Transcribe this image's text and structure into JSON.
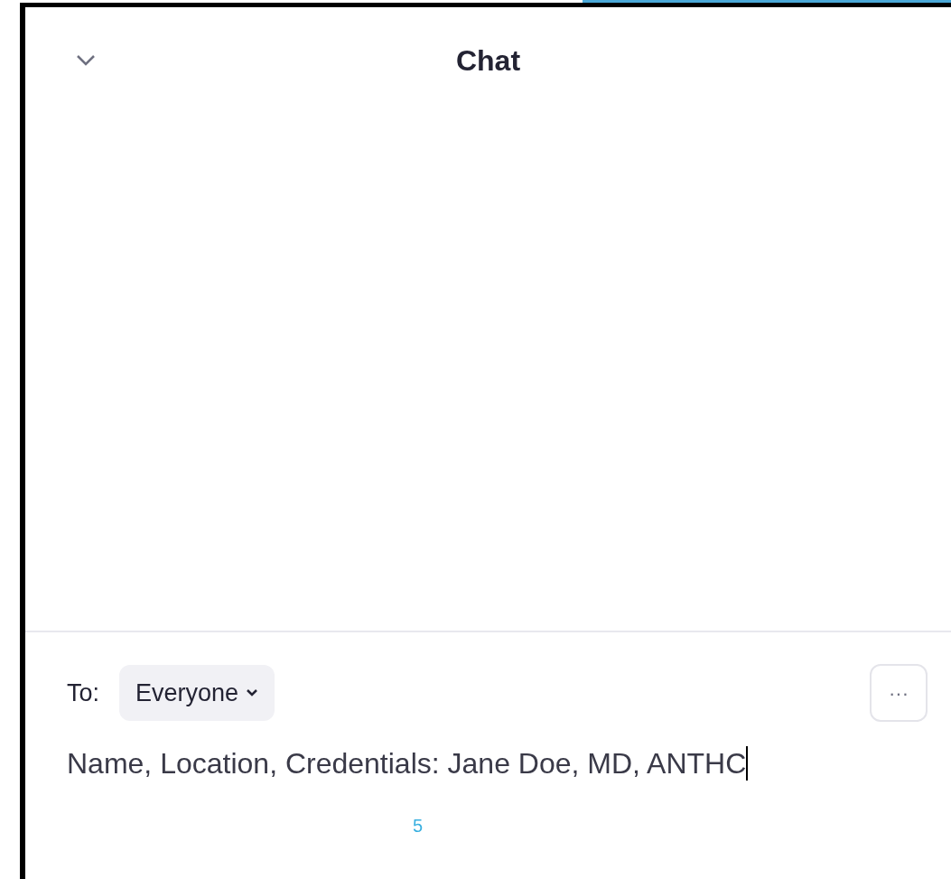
{
  "chat_panel": {
    "title": "Chat",
    "recipient_label": "To:",
    "recipient": "Everyone",
    "message": "Name, Location, Credentials: Jane Doe, MD, ANTHC",
    "more_button": "···",
    "annotation": "5"
  }
}
